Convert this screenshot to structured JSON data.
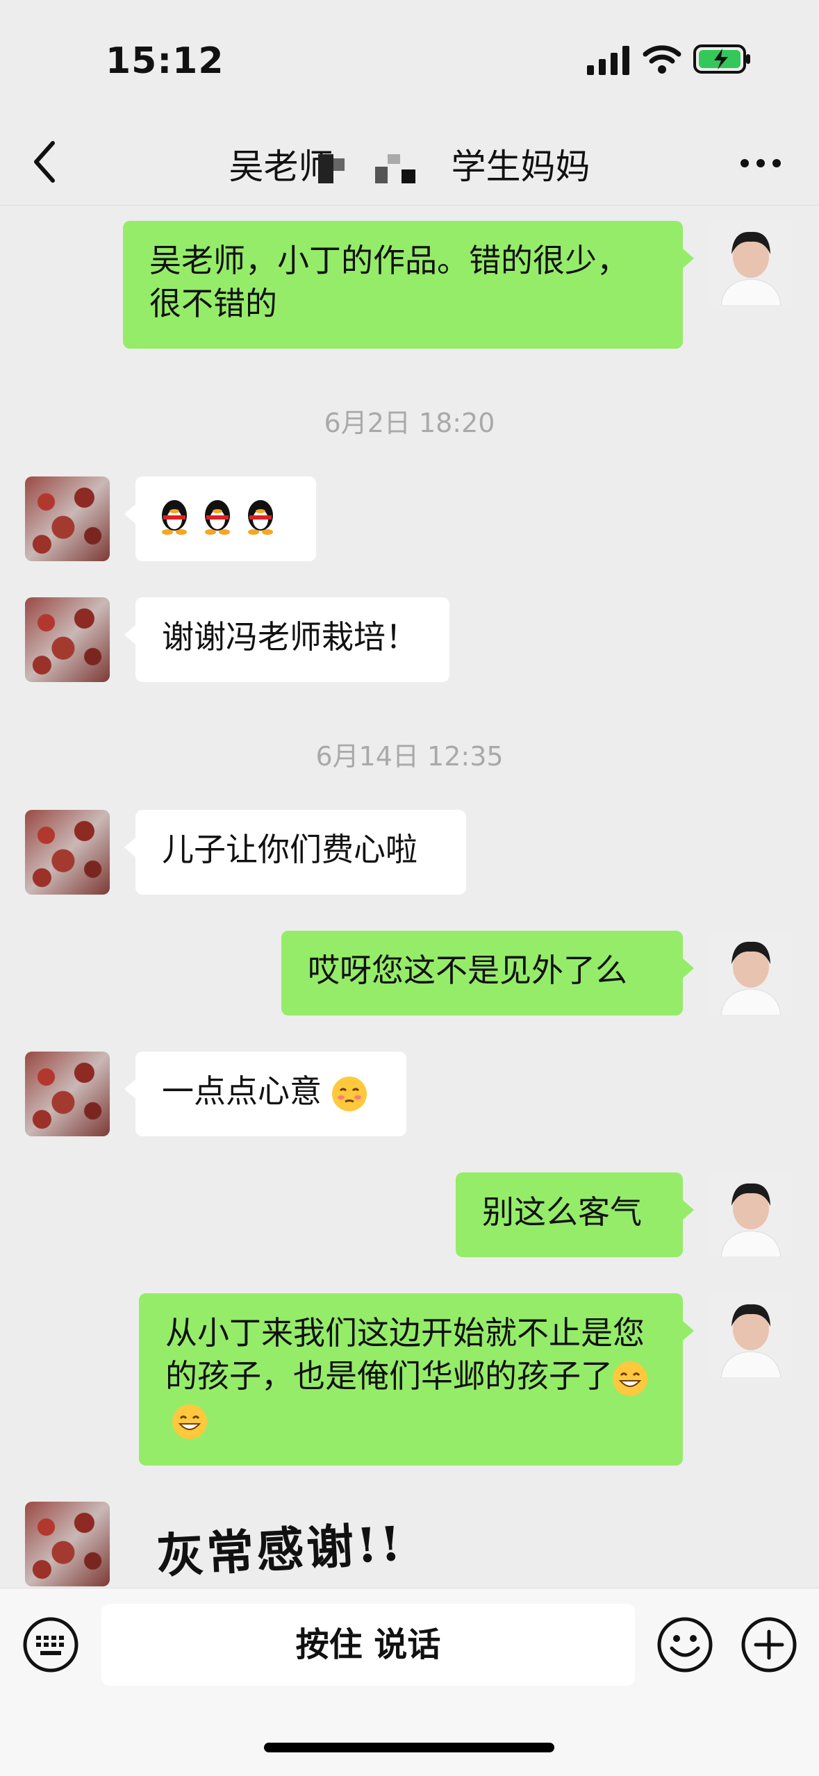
{
  "status_bar": {
    "time": "15:12"
  },
  "nav": {
    "title_prefix": "吴老师",
    "title_suffix": "学生妈妈",
    "back_icon": "chevron-left-icon",
    "more_icon": "more-dots-icon"
  },
  "messages": [
    {
      "side": "right",
      "text": "吴老师，小丁的作品。错的很少，很不错的"
    },
    {
      "type": "timestamp",
      "text": "6月2日 18:20"
    },
    {
      "side": "left",
      "type": "emoji-only",
      "emoji": "penguin-emoji",
      "count": 3
    },
    {
      "side": "left",
      "text": "谢谢冯老师栽培！"
    },
    {
      "type": "timestamp",
      "text": "6月14日 12:35"
    },
    {
      "side": "left",
      "text": "儿子让你们费心啦"
    },
    {
      "side": "right",
      "text": "哎呀您这不是见外了么"
    },
    {
      "side": "left",
      "text": "一点点心意",
      "emoji": "shy-face-emoji"
    },
    {
      "side": "right",
      "text": "别这么客气"
    },
    {
      "side": "right",
      "text": "从小丁来我们这边开始就不止是您的孩子，也是俺们华邺的孩子了",
      "emoji": "grin-emoji",
      "emoji_count": 2
    },
    {
      "side": "left",
      "type": "sticker",
      "text": "灰常感谢!!"
    }
  ],
  "input_bar": {
    "hold_to_talk": "按住 说话",
    "keyboard_icon": "keyboard-icon",
    "emoji_icon": "smile-icon",
    "plus_icon": "plus-icon"
  }
}
